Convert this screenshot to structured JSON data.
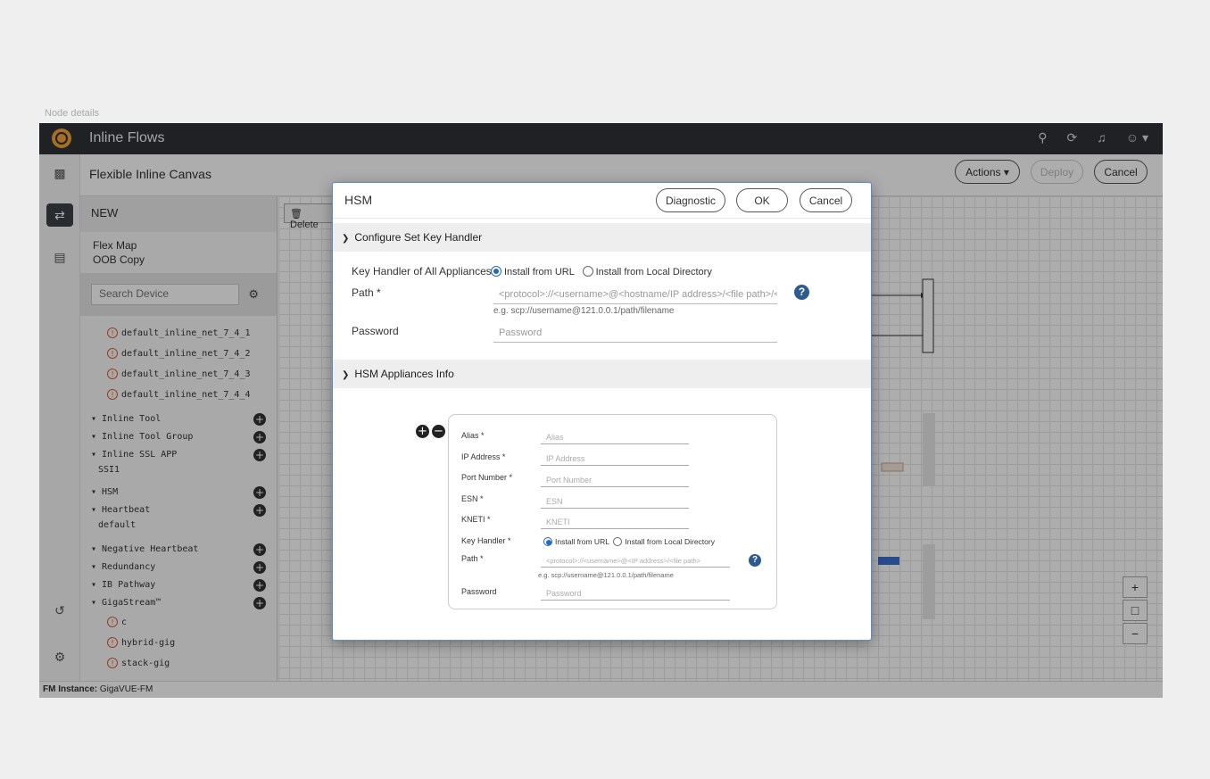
{
  "page_caption": "Node details",
  "app": {
    "title": "Inline Flows",
    "top_icons": [
      "search-icon",
      "refresh-icon",
      "bell-icon",
      "user-icon"
    ],
    "subtitle": "Flexible Inline Canvas",
    "actions_label": "Actions ▾",
    "deploy_label": "Deploy",
    "cancel_label": "Cancel"
  },
  "left_panel": {
    "new_label": "NEW",
    "flex_map": "Flex Map",
    "oob_copy": "OOB Copy",
    "search_placeholder": "Search Device",
    "nets": [
      "default_inline_net_7_4_1",
      "default_inline_net_7_4_2",
      "default_inline_net_7_4_3",
      "default_inline_net_7_4_4"
    ],
    "groups": {
      "inline_tool": "▾ Inline Tool",
      "inline_tool_group": "▾ Inline Tool Group",
      "inline_ssl_app": "▾ Inline SSL APP",
      "ssl_child": "SSI1",
      "hsm": "▾ HSM",
      "heartbeat": "▾ Heartbeat",
      "heartbeat_child": "default",
      "negative_heartbeat": "▾ Negative Heartbeat",
      "redundancy": "▾ Redundancy",
      "ib_pathway": "▾ IB Pathway",
      "gigastream": "▾ GigaStream™"
    },
    "gigastream_items": [
      "c",
      "hybrid-gig",
      "stack-gig"
    ]
  },
  "canvas": {
    "delete_label": "Delete"
  },
  "status": {
    "prefix": "FM Instance:",
    "value": " GigaVUE-FM"
  },
  "modal": {
    "title": "HSM",
    "diagnostic": "Diagnostic",
    "ok": "OK",
    "cancel": "Cancel",
    "section1": "Configure Set Key Handler",
    "key_handler_label": "Key Handler of All Appliances *",
    "opt_url": "Install from URL",
    "opt_local": "Install from Local Directory",
    "path_label": "Path *",
    "path_placeholder": "<protocol>://<username>@<hostname/IP address>/<file path>/<file name>",
    "path_hint": "e.g. scp://username@121.0.0.1/path/filename",
    "password_label": "Password",
    "password_placeholder": "Password",
    "section2": "HSM Appliances Info",
    "card": {
      "alias_label": "Alias *",
      "alias_ph": "Alias",
      "ip_label": "IP Address *",
      "ip_ph": "IP Address",
      "port_label": "Port Number *",
      "port_ph": "Port Number",
      "esn_label": "ESN *",
      "esn_ph": "ESN",
      "kneti_label": "KNETI *",
      "kneti_ph": "KNETI",
      "kh_label": "Key Handler *",
      "opt_url": "Install from URL",
      "opt_local": "Install from Local Directory",
      "path_label": "Path *",
      "path_ph": "<protocol>://<username>@<IP address>/<file path>",
      "path_hint": "e.g. scp://username@121.0.0.1/path/filename",
      "password_label": "Password",
      "password_ph": "Password"
    }
  }
}
